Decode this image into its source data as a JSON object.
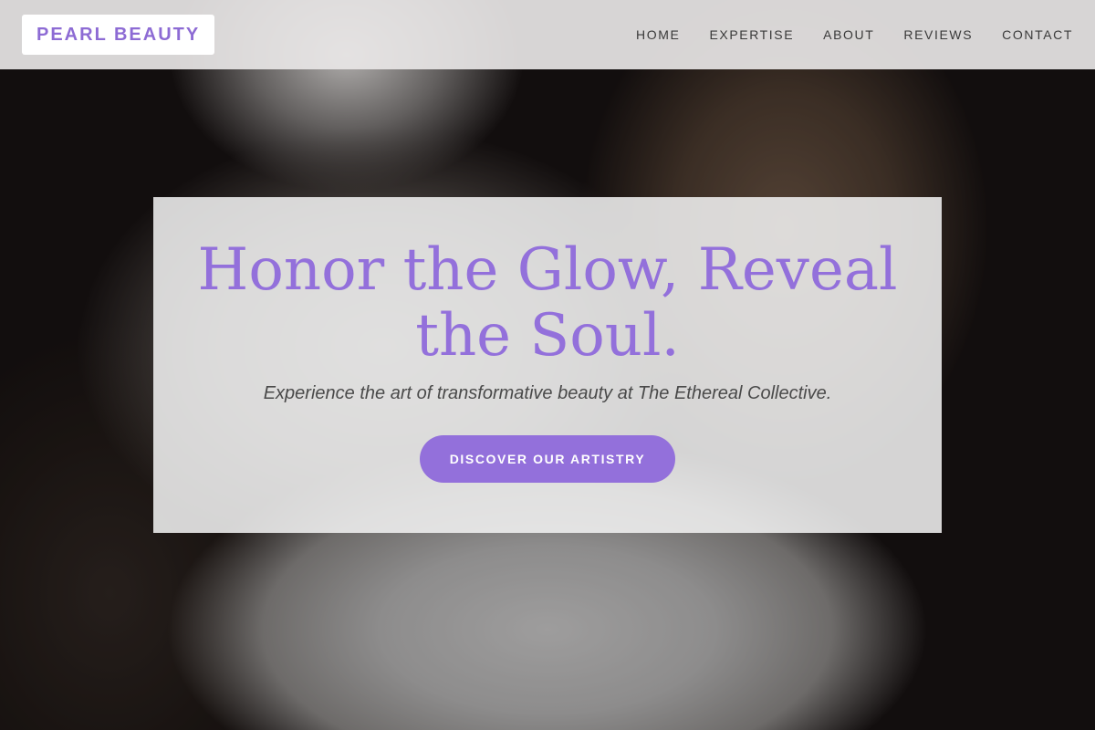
{
  "brand": {
    "name": "PEARL BEAUTY",
    "accent_color": "#9370db"
  },
  "nav": {
    "items": [
      {
        "label": "HOME"
      },
      {
        "label": "EXPERTISE"
      },
      {
        "label": "ABOUT"
      },
      {
        "label": "REVIEWS"
      },
      {
        "label": "CONTACT"
      }
    ]
  },
  "hero": {
    "title": "Honor the Glow, Reveal the Soul.",
    "subtitle": "Experience the art of transformative beauty at The Ethereal Collective.",
    "cta_label": "DISCOVER OUR ARTISTRY"
  }
}
